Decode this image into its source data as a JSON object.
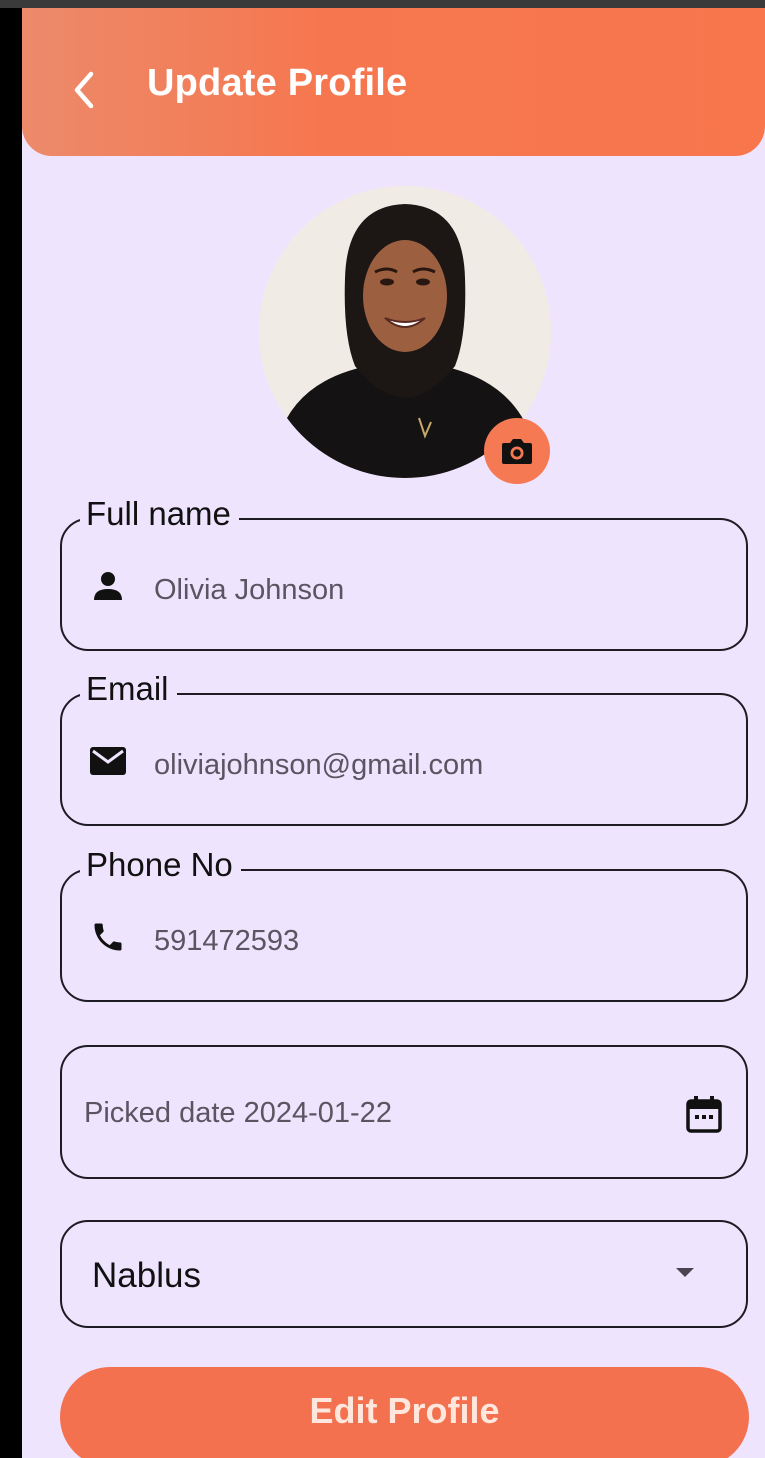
{
  "appbar": {
    "title": "Update Profile"
  },
  "profile": {
    "photo_alt": "profile photo"
  },
  "fields": {
    "full_name": {
      "label": "Full name",
      "value": "Olivia Johnson"
    },
    "email": {
      "label": "Email",
      "value": "oliviajohnson@gmail.com"
    },
    "phone": {
      "label": "Phone No",
      "value": "591472593"
    }
  },
  "date_picker": {
    "value": "Picked date 2024-01-22"
  },
  "city_select": {
    "value": "Nablus"
  },
  "submit": {
    "label": "Edit Profile"
  },
  "colors": {
    "accent": "#f6774f",
    "background": "#efe4fe",
    "border": "#1f1b22"
  }
}
